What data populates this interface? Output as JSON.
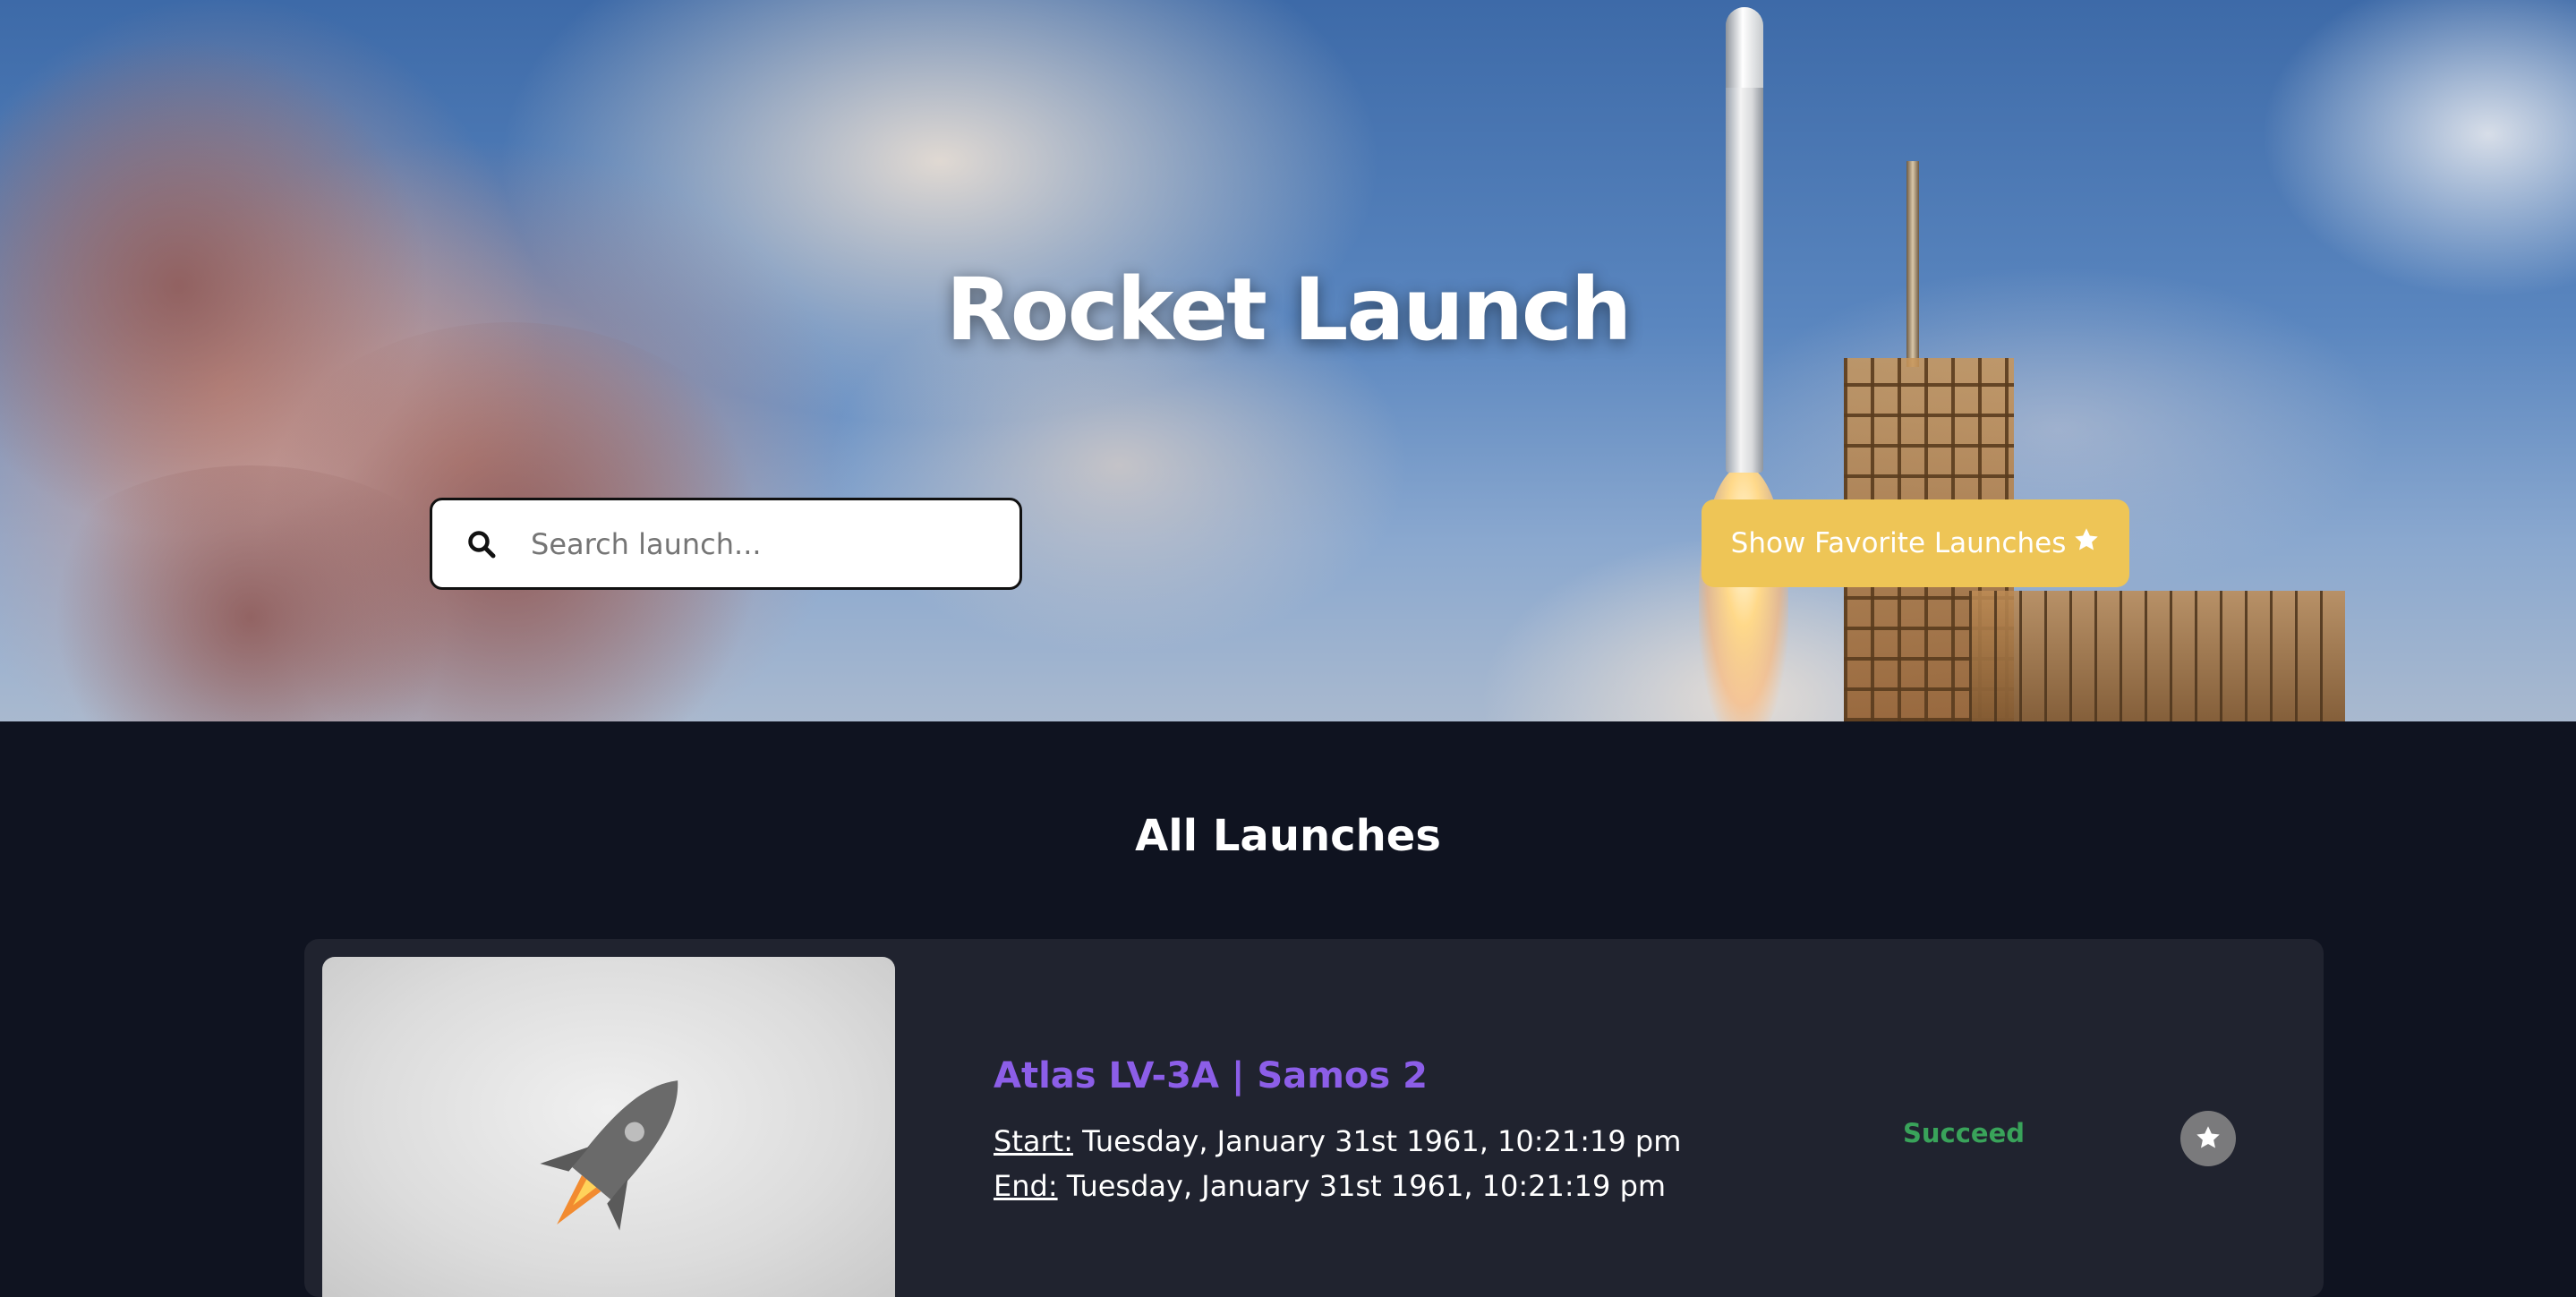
{
  "hero": {
    "title": "Rocket Launch",
    "search": {
      "placeholder": "Search launch...",
      "value": ""
    },
    "favorites_button": {
      "label": "Show Favorite Launches",
      "icon": "star-icon",
      "color": "#eec556"
    }
  },
  "launches": {
    "heading": "All Launches",
    "items": [
      {
        "name": "Atlas LV-3A | Samos 2",
        "start_label": "Start:",
        "start": "Tuesday, January 31st 1961, 10:21:19 pm",
        "end_label": "End:",
        "end": "Tuesday, January 31st 1961, 10:21:19 pm",
        "status": "Succeed",
        "status_color": "#39a35a",
        "image_icon": "rocket-icon",
        "favorite_icon": "star-icon"
      }
    ]
  },
  "colors": {
    "background": "#0f1320",
    "card": "#20232f",
    "title_accent": "#8c5ee8"
  }
}
